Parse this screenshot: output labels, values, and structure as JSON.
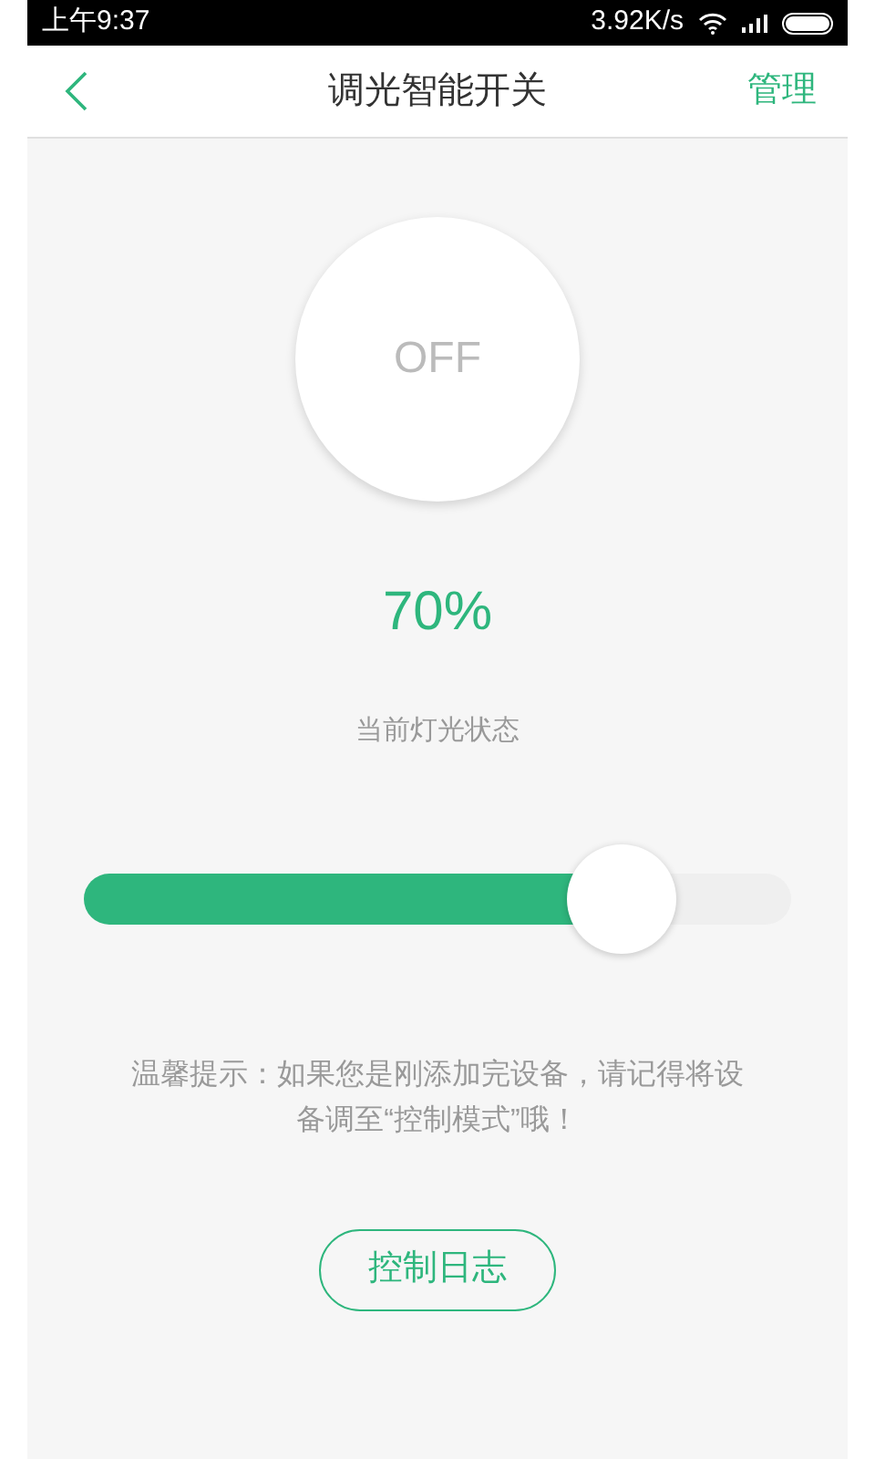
{
  "status_bar": {
    "time": "上午9:37",
    "speed": "3.92K/s"
  },
  "header": {
    "title": "调光智能开关",
    "action": "管理"
  },
  "power_button": {
    "label": "OFF"
  },
  "brightness": {
    "value": "70%",
    "caption": "当前灯光状态",
    "level": 0.76
  },
  "tip": "温馨提示：如果您是刚添加完设备，请记得将设备调至“控制模式”哦！",
  "log_button": "控制日志"
}
